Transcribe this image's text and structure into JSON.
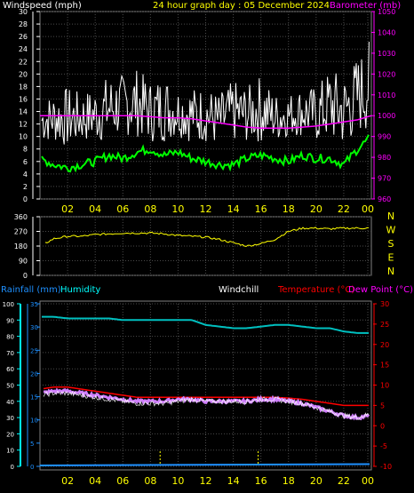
{
  "header": {
    "windspeed_label": "Windspeed (mph)",
    "title": "24 hour graph day : 05 December 2024",
    "barometer_label": "Barometer (mb)"
  },
  "bottom_header": {
    "rainfall_label": "Rainfall (mm)",
    "humidity_label": "Humidity",
    "windchill_label": "Windchill",
    "temperature_label": "Temperature (°C)",
    "dewpoint_label": "Dew Point (°C)"
  },
  "colors": {
    "windspeed": "#ffffff",
    "gust_low": "#00ff00",
    "barometer": "#ff00ff",
    "direction": "#ffff00",
    "humidity": "#00c0c0",
    "rainfall": "#1e90ff",
    "temperature": "#ff0000",
    "dewpoint": "#d080ff",
    "windchill": "#ffffff",
    "axis_pink": "#ff00ff",
    "axis_red": "#ff0000",
    "axis_cyan": "#00ffff"
  },
  "chart_data": [
    {
      "type": "line",
      "panel": "wind-barometer",
      "x_ticks": [
        "02",
        "04",
        "06",
        "08",
        "10",
        "12",
        "14",
        "16",
        "18",
        "20",
        "22",
        "00"
      ],
      "y_left": {
        "label": "Windspeed (mph)",
        "ylim": [
          0,
          30
        ],
        "ticks": [
          "0",
          "2",
          "4",
          "6",
          "8",
          "10",
          "12",
          "14",
          "16",
          "18",
          "20",
          "22",
          "24",
          "26",
          "28",
          "30"
        ]
      },
      "y_right": {
        "label": "Barometer (mb)",
        "ylim": [
          960,
          1050
        ],
        "ticks": [
          "960",
          "970",
          "980",
          "990",
          "1000",
          "1010",
          "1020",
          "1030",
          "1040",
          "1050"
        ]
      },
      "grid": true,
      "series": [
        {
          "name": "Windspeed (mph)",
          "axis": "left",
          "x": [
            0,
            1,
            2,
            3,
            4,
            5,
            6,
            7,
            8,
            9,
            10,
            11,
            12,
            13,
            14,
            15,
            16,
            17,
            18,
            19,
            20,
            21,
            22,
            23,
            24
          ],
          "low": [
            9,
            9,
            8,
            9,
            9,
            9,
            10,
            10,
            9,
            9,
            10,
            9,
            9,
            8,
            9,
            9,
            9,
            9,
            10,
            10,
            9,
            9,
            8,
            10,
            11
          ],
          "high": [
            16,
            17,
            18,
            17,
            18,
            20,
            20,
            21,
            19,
            20,
            18,
            18,
            18,
            17,
            19,
            18,
            20,
            17,
            17,
            18,
            18,
            21,
            20,
            23,
            26
          ]
        },
        {
          "axis": "left",
          "x": [
            0,
            1,
            2,
            3,
            4,
            5,
            6,
            7,
            8,
            9,
            10,
            11,
            12,
            13,
            14,
            15,
            16,
            17,
            18,
            19,
            20,
            21,
            22,
            23,
            24
          ],
          "y": [
            6.5,
            5.5,
            5.0,
            5.5,
            6.0,
            7.0,
            6.5,
            7.5,
            8.0,
            7.0,
            7.5,
            6.5,
            6.0,
            5.5,
            5.5,
            6.5,
            7.0,
            6.5,
            6.0,
            7.0,
            6.5,
            6.5,
            5.5,
            8.0,
            10.0
          ]
        },
        {
          "name": "Barometer (mb)",
          "axis": "right",
          "x": [
            0,
            1,
            2,
            3,
            4,
            5,
            6,
            7,
            8,
            9,
            10,
            11,
            12,
            13,
            14,
            15,
            16,
            17,
            18,
            19,
            20,
            21,
            22,
            23,
            24
          ],
          "y": [
            1000,
            1000,
            1000,
            1000,
            1000,
            1000,
            1000,
            1000,
            999.5,
            999,
            999,
            998.5,
            997.5,
            996.5,
            995.5,
            994.5,
            994,
            994,
            994,
            994.5,
            995,
            996,
            997,
            998,
            1000
          ]
        }
      ]
    },
    {
      "type": "line",
      "panel": "wind-direction",
      "y_left": {
        "ylim": [
          0,
          360
        ],
        "ticks": [
          "0",
          "90",
          "180",
          "270",
          "360"
        ]
      },
      "y_right_labels": [
        "N",
        "W",
        "S",
        "E",
        "N"
      ],
      "grid": true,
      "series": [
        {
          "axis": "left",
          "x": [
            0,
            1,
            2,
            3,
            4,
            5,
            6,
            7,
            8,
            9,
            10,
            11,
            12,
            13,
            14,
            15,
            16,
            17,
            18,
            19,
            20,
            21,
            22,
            23,
            24
          ],
          "y": [
            180,
            225,
            240,
            240,
            250,
            255,
            260,
            260,
            260,
            255,
            245,
            240,
            235,
            220,
            200,
            180,
            195,
            220,
            270,
            290,
            290,
            285,
            290,
            290,
            290
          ]
        }
      ]
    },
    {
      "type": "line",
      "panel": "temperature-humidity-rain",
      "x_ticks": [
        "02",
        "04",
        "06",
        "08",
        "10",
        "12",
        "14",
        "16",
        "18",
        "20",
        "22",
        "00"
      ],
      "y_left_rain": {
        "label": "Rainfall (mm)",
        "ylim": [
          0,
          35
        ],
        "ticks": [
          "0",
          "5",
          "10",
          "15",
          "20",
          "25",
          "30",
          "35"
        ]
      },
      "y_left_humidity": {
        "label": "Humidity",
        "ylim": [
          0,
          100
        ],
        "ticks": [
          "0",
          "10",
          "20",
          "30",
          "40",
          "50",
          "60",
          "70",
          "80",
          "90",
          "100"
        ]
      },
      "y_right": {
        "label": "Temperature (°C)",
        "ylim": [
          -10,
          30
        ],
        "ticks": [
          "-10",
          "-5",
          "0",
          "5",
          "10",
          "15",
          "20",
          "25",
          "30"
        ]
      },
      "grid": true,
      "series": [
        {
          "name": "Humidity",
          "axis": "humidity",
          "x": [
            0,
            1,
            2,
            3,
            4,
            5,
            6,
            7,
            8,
            9,
            10,
            11,
            12,
            13,
            14,
            15,
            16,
            17,
            18,
            19,
            20,
            21,
            22,
            23,
            24
          ],
          "y": [
            92,
            92,
            91,
            91,
            91,
            91,
            90,
            90,
            90,
            90,
            90,
            90,
            87,
            86,
            85,
            85,
            86,
            87,
            87,
            86,
            85,
            85,
            83,
            82,
            82
          ]
        },
        {
          "name": "Rainfall (mm)",
          "axis": "rain",
          "x": [
            0,
            24
          ],
          "y": [
            0,
            0.1
          ]
        },
        {
          "name": "Temperature (°C)",
          "axis": "temp",
          "x": [
            0,
            1,
            2,
            3,
            4,
            5,
            6,
            7,
            8,
            9,
            10,
            11,
            12,
            13,
            14,
            15,
            16,
            17,
            18,
            19,
            20,
            21,
            22,
            23,
            24
          ],
          "y": [
            9.0,
            9.5,
            9.5,
            9.0,
            8.5,
            8.0,
            7.5,
            7.0,
            7.0,
            7.0,
            7.0,
            7.0,
            7.0,
            7.0,
            7.0,
            7.0,
            7.0,
            7.0,
            6.8,
            6.5,
            6.0,
            5.5,
            5.0,
            5.0,
            5.0
          ]
        },
        {
          "name": "Dew Point (°C)",
          "axis": "temp",
          "x": [
            0,
            1,
            2,
            3,
            4,
            5,
            6,
            7,
            8,
            9,
            10,
            11,
            12,
            13,
            14,
            15,
            16,
            17,
            18,
            19,
            20,
            21,
            22,
            23,
            24
          ],
          "y": [
            8.0,
            8.5,
            8.5,
            8.0,
            7.5,
            7.0,
            6.5,
            6.0,
            6.0,
            6.0,
            6.5,
            6.5,
            6.0,
            6.0,
            6.0,
            6.0,
            6.5,
            6.5,
            6.0,
            5.5,
            4.5,
            3.5,
            2.5,
            2.0,
            2.5
          ]
        },
        {
          "name": "Windchill",
          "axis": "temp",
          "x": [
            0,
            1,
            2,
            3,
            4,
            5,
            6,
            7,
            8,
            9,
            10,
            11,
            12,
            13,
            14,
            15,
            16,
            17,
            18,
            19,
            20,
            21,
            22,
            23,
            24
          ],
          "y": [
            7.5,
            8.0,
            8.0,
            7.5,
            7.0,
            6.5,
            6.0,
            5.5,
            5.5,
            5.5,
            6.0,
            6.5,
            6.0,
            6.0,
            6.0,
            6.0,
            6.5,
            6.5,
            6.0,
            5.5,
            4.5,
            3.5,
            2.5,
            2.0,
            3.0
          ]
        }
      ],
      "markers_x": [
        8.7,
        15.8
      ]
    }
  ]
}
